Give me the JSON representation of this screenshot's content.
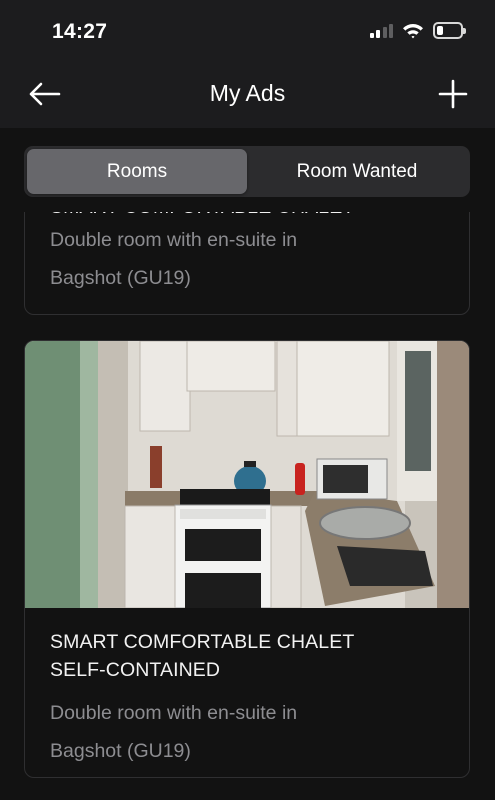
{
  "status_bar": {
    "time": "14:27",
    "signal_bars": 2,
    "battery_level": 0.25
  },
  "nav": {
    "title": "My Ads",
    "back_icon": "arrow-left-icon",
    "add_icon": "plus-icon"
  },
  "tabs": [
    {
      "label": "Rooms",
      "active": true
    },
    {
      "label": "Room Wanted",
      "active": false
    }
  ],
  "ads": [
    {
      "title": "SMART COMFORTABLE CHALET",
      "subtitle_line1": "Double room with en-suite in",
      "subtitle_line2": "Bagshot (GU19)"
    },
    {
      "image": "kitchen-photo",
      "title_line1": "SMART COMFORTABLE CHALET",
      "title_line2": "SELF-CONTAINED",
      "subtitle_line1": "Double room with en-suite in",
      "subtitle_line2": "Bagshot (GU19)"
    }
  ],
  "colors": {
    "background": "#121212",
    "top_bar": "#1c1c1e",
    "segment_track": "#2c2c2e",
    "segment_active": "#67676b",
    "subtitle": "#8d8d91"
  }
}
